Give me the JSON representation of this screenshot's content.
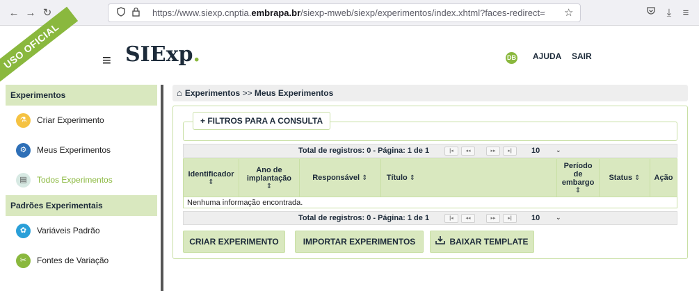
{
  "browser": {
    "url_prefix": "https://www.siexp.cnptia.",
    "url_domain": "embrapa.br",
    "url_suffix": "/siexp-mweb/siexp/experimentos/index.xhtml?faces-redirect=true",
    "icons": [
      "back-icon",
      "forward-icon",
      "reload-icon",
      "shield-icon",
      "lock-icon",
      "bookmark-star-icon",
      "pocket-icon",
      "download-icon",
      "menu-icon"
    ]
  },
  "header": {
    "ribbon": "USO OFICIAL",
    "logo_main": "SIExp",
    "logo_dot": ".",
    "user_initials": "DB",
    "help": "AJUDA",
    "logout": "SAIR"
  },
  "sidebar": {
    "section1": "Experimentos",
    "items1": [
      {
        "label": "Criar Experimento",
        "icon": "flask-icon",
        "active": false
      },
      {
        "label": "Meus Experimentos",
        "icon": "gear-icon",
        "active": false
      },
      {
        "label": "Todos Experimentos",
        "icon": "clipboard-icon",
        "active": true
      }
    ],
    "section2": "Padrões Experimentais",
    "items2": [
      {
        "label": "Variáveis Padrão",
        "icon": "settings-icon"
      },
      {
        "label": "Fontes de Variação",
        "icon": "tools-icon"
      }
    ]
  },
  "breadcrumb": {
    "part1": "Experimentos",
    "separator": ">>",
    "part2": "Meus Experimentos"
  },
  "filters": {
    "label": "+ FILTROS PARA A CONSULTA"
  },
  "paginator": {
    "text": "Total de registros: 0 - Página: 1 de 1",
    "rows_per_page": "10"
  },
  "table": {
    "headers": [
      "Identificador",
      "Ano de implantação",
      "Responsável",
      "Título",
      "Período de embargo",
      "Status",
      "Ação"
    ],
    "empty_message": "Nenhuma informação encontrada."
  },
  "actions": {
    "create": "CRIAR EXPERIMENTO",
    "import": "IMPORTAR EXPERIMENTOS",
    "download": "BAIXAR TEMPLATE"
  },
  "colors": {
    "accent": "#8ab83e",
    "header_bg": "#d9e8bf"
  }
}
